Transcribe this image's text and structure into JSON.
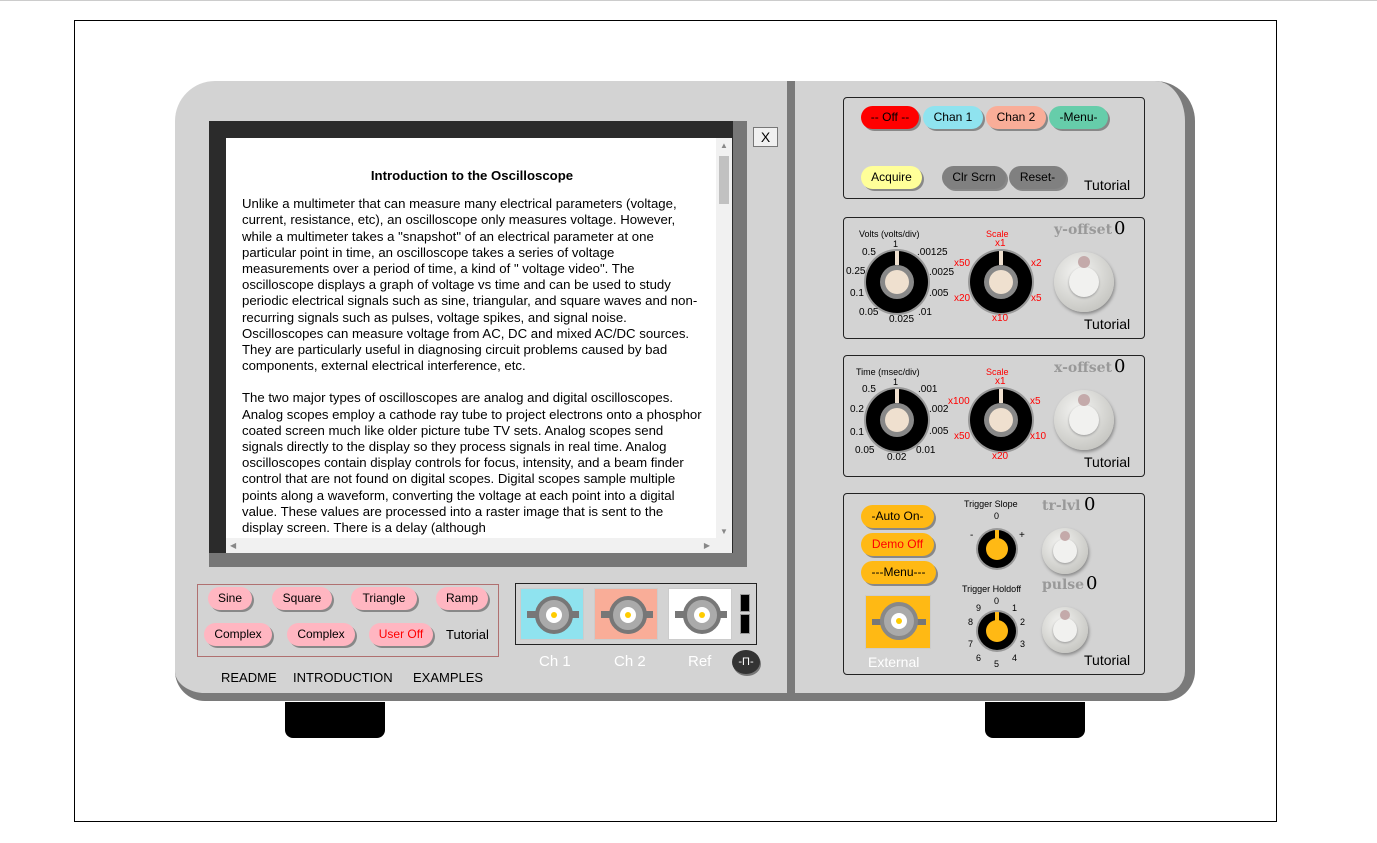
{
  "screen": {
    "title": "Introduction to the Oscilloscope",
    "paragraphs": [
      "Unlike a multimeter that can measure many electrical parameters (voltage, current, resistance, etc), an oscilloscope only measures voltage. However, while a multimeter takes a \"snapshot\" of an electrical parameter at one particular point in time, an oscilloscope takes a series of voltage measurements over a period of time, a kind of \" voltage video\". The oscilloscope displays a graph of voltage vs time and can be used to study periodic electrical signals such as sine, triangular, and square waves and non-recurring signals such as pulses, voltage spikes, and signal noise. Oscilloscopes can measure voltage from AC, DC and mixed AC/DC sources. They are particularly useful in diagnosing circuit problems caused by bad components, external electrical interference, etc.",
      "The two major types of oscilloscopes are analog and digital oscilloscopes. Analog scopes employ a cathode ray tube to project electrons onto a phosphor coated screen much like older picture tube TV sets. Analog scopes send signals directly to the display so they process signals in real time. Analog oscilloscopes contain display controls for focus, intensity, and a beam finder control that are not found on digital scopes. Digital scopes sample multiple points along a waveform, converting the voltage at each point into a digital value. These values are processed into a raster image that is sent to the display screen. There is a delay (although"
    ],
    "close_label": "X"
  },
  "signals": {
    "buttons": [
      "Sine",
      "Square",
      "Triangle",
      "Ramp",
      "Complex",
      "Complex",
      "User Off"
    ],
    "tutorial": "Tutorial"
  },
  "links": [
    "README",
    "INTRODUCTION",
    "EXAMPLES"
  ],
  "inputs": {
    "ch1": "Ch 1",
    "ch2": "Ch 2",
    "ref": "Ref",
    "pulse_btn": "-Π-"
  },
  "top": {
    "off": "-- Off --",
    "chan1": "Chan 1",
    "chan2": "Chan 2",
    "menu": "-Menu-",
    "acquire": "Acquire",
    "clr": "Clr Scrn",
    "reset": "Reset-",
    "tutorial": "Tutorial"
  },
  "volts": {
    "label": "Volts (volts/div)",
    "ticks": [
      "1",
      ".00125",
      ".0025",
      ".005",
      ".01",
      "0.025",
      "0.05",
      "0.1",
      "0.25",
      "0.5"
    ],
    "scale_label": "Scale",
    "scale_ticks": [
      "x1",
      "x2",
      "x5",
      "x10",
      "x20",
      "x50"
    ],
    "offset_label": "y-offset",
    "offset_value": "0",
    "tutorial": "Tutorial"
  },
  "time": {
    "label": "Time (msec/div)",
    "ticks": [
      "1",
      ".001",
      ".002",
      ".005",
      "0.01",
      "0.02",
      "0.05",
      "0.1",
      "0.2",
      "0.5"
    ],
    "scale_label": "Scale",
    "scale_ticks": [
      "x1",
      "x5",
      "x10",
      "x20",
      "x50",
      "x100"
    ],
    "offset_label": "x-offset",
    "offset_value": "0",
    "tutorial": "Tutorial"
  },
  "trigger": {
    "auto": "-Auto On-",
    "demo": "Demo Off",
    "menu": "---Menu---",
    "external": "External",
    "slope_label": "Trigger Slope",
    "slope_ticks": [
      "0",
      "-",
      "+"
    ],
    "holdoff_label": "Trigger Holdoff",
    "holdoff_ticks": [
      "0",
      "1",
      "2",
      "3",
      "4",
      "5",
      "6",
      "7",
      "8",
      "9"
    ],
    "level_label": "tr-lvl",
    "level_value": "0",
    "pulse_label": "pulse",
    "pulse_value": "0",
    "tutorial": "Tutorial"
  },
  "colors": {
    "off": "#ff0000",
    "chan1": "#8fe3ef",
    "chan2": "#f9ad98",
    "menu": "#66cdaa",
    "acquire": "#ffff99",
    "gray": "#808080",
    "signal": "#ffb6c1",
    "trigger": "#ffb914"
  }
}
